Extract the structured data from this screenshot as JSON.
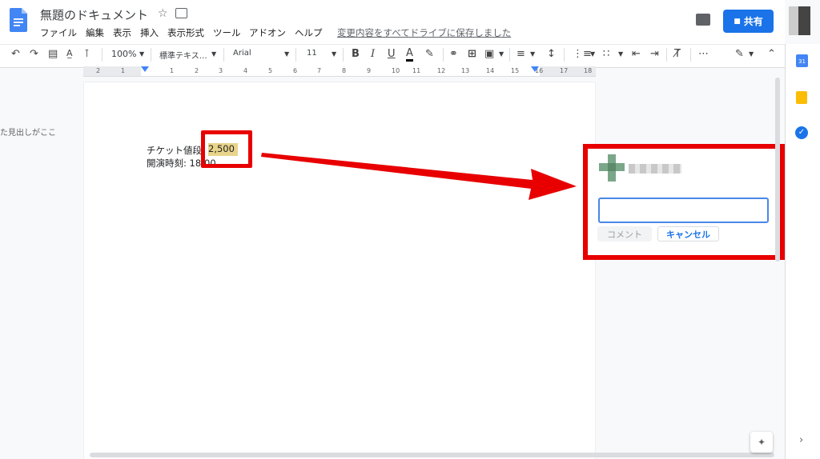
{
  "app": {
    "title": "無題のドキュメント",
    "save_status": "変更内容をすべてドライブに保存しました"
  },
  "menu": [
    "ファイル",
    "編集",
    "表示",
    "挿入",
    "表示形式",
    "ツール",
    "アドオン",
    "ヘルプ"
  ],
  "header": {
    "share_label": "共有"
  },
  "toolbar": {
    "zoom": "100%",
    "style": "標準テキス…",
    "font": "Arial",
    "size": "11",
    "bold": "B",
    "italic": "I",
    "underline": "U",
    "text_color": "A",
    "more": "⋯"
  },
  "ruler": {
    "ticks": [
      "2",
      "1",
      "1",
      "2",
      "3",
      "4",
      "5",
      "6",
      "7",
      "8",
      "9",
      "10",
      "11",
      "12",
      "13",
      "14",
      "15",
      "16",
      "17",
      "18"
    ]
  },
  "outline": {
    "hint": "た見出しがここ"
  },
  "document": {
    "line1_label": "チケット値段:",
    "line1_value": "2,500",
    "line2": "開演時刻: 18:00"
  },
  "comment": {
    "input_value": "",
    "submit_label": "コメント",
    "cancel_label": "キャンセル"
  },
  "side": {
    "calendar_day": "31"
  },
  "colors": {
    "accent": "#1a73e8",
    "annotation": "#e80000",
    "highlight": "#e8d48b"
  }
}
